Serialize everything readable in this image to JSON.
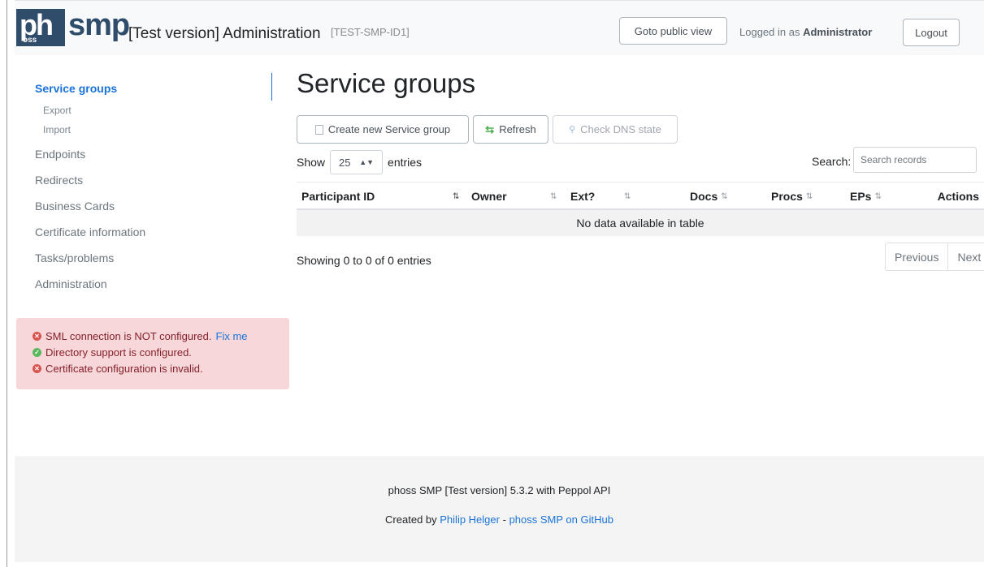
{
  "header": {
    "logo_ph": "ph",
    "logo_oss": "oss",
    "logo_smp": "smp",
    "title": "[Test version] Administration",
    "instance_id": "[TEST-SMP-ID1]",
    "public_view_button": "Goto public view",
    "logged_in_prefix": "Logged in as",
    "logged_in_user": "Administrator",
    "logout_button": "Logout"
  },
  "sidebar": {
    "items": [
      {
        "label": "Service groups",
        "active": true
      },
      {
        "label": "Export"
      },
      {
        "label": "Import"
      },
      {
        "label": "Endpoints"
      },
      {
        "label": "Redirects"
      },
      {
        "label": "Business Cards"
      },
      {
        "label": "Certificate information"
      },
      {
        "label": "Tasks/problems"
      },
      {
        "label": "Administration"
      }
    ]
  },
  "status": {
    "sml_text": "SML connection is NOT configured.",
    "sml_fix": "Fix me",
    "directory_text": "Directory support is configured.",
    "certificate_text": "Certificate configuration is invalid."
  },
  "main": {
    "title": "Service groups",
    "toolbar": {
      "create": "Create new Service group",
      "refresh": "Refresh",
      "check_dns": "Check DNS state"
    },
    "show_label": "Show",
    "entries_value": "25",
    "entries_label": "entries",
    "search_label": "Search:",
    "search_placeholder": "Search records",
    "columns": [
      "Participant ID",
      "Owner",
      "Ext?",
      "Docs",
      "Procs",
      "EPs",
      "Actions"
    ],
    "empty_text": "No data available in table",
    "info_text": "Showing 0 to 0 of 0 entries",
    "pager": {
      "previous": "Previous",
      "next": "Next"
    }
  },
  "footer": {
    "version": "phoss SMP [Test version] 5.3.2 with Peppol API",
    "created_by": "Created by",
    "author": "Philip Helger",
    "separator": "-",
    "github": "phoss SMP on GitHub"
  },
  "colors": {
    "brand": "#2f4c6b",
    "link": "#1a73d9",
    "alert_bg": "#f8d7da",
    "alert_text": "#842029"
  }
}
